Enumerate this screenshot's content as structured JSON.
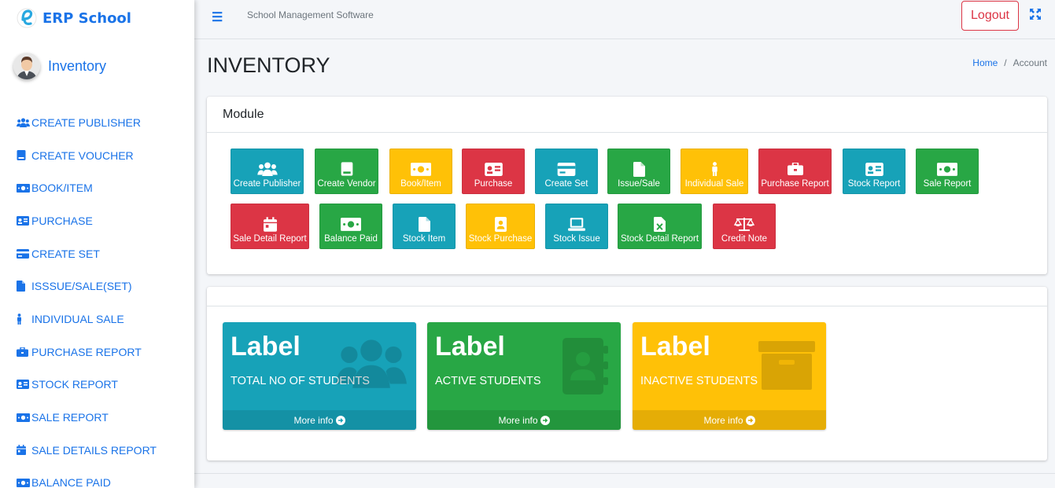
{
  "brand": {
    "name": "ERP School"
  },
  "user": {
    "name": "Inventory"
  },
  "sidebar": {
    "items": [
      {
        "label": "CREATE PUBLISHER",
        "icon": "users-icon"
      },
      {
        "label": "CREATE VOUCHER",
        "icon": "book-icon"
      },
      {
        "label": "BOOK/ITEM",
        "icon": "money-icon"
      },
      {
        "label": "PURCHASE",
        "icon": "id-card-icon"
      },
      {
        "label": "CREATE SET",
        "icon": "credit-card-icon"
      },
      {
        "label": "ISSSUE/SALE(SET)",
        "icon": "file-icon"
      },
      {
        "label": "INDIVIDUAL SALE",
        "icon": "person-icon"
      },
      {
        "label": "PURCHASE REPORT",
        "icon": "briefcase-icon"
      },
      {
        "label": "STOCK REPORT",
        "icon": "id-card-icon"
      },
      {
        "label": "SALE REPORT",
        "icon": "money-icon"
      },
      {
        "label": "SALE DETAILS REPORT",
        "icon": "calendar-icon"
      },
      {
        "label": "BALANCE PAID",
        "icon": "money-icon"
      }
    ]
  },
  "topbar": {
    "app_name": "School Management Software",
    "logout_label": "Logout"
  },
  "header": {
    "title": "INVENTORY",
    "breadcrumb_home": "Home",
    "breadcrumb_sep": "/",
    "breadcrumb_current": "Account"
  },
  "module": {
    "title": "Module",
    "buttons": [
      {
        "label": "Create Publisher",
        "color": "#17a2b8",
        "icon": "users-icon"
      },
      {
        "label": "Create Vendor",
        "color": "#28a745",
        "icon": "book-icon"
      },
      {
        "label": "Book/Item",
        "color": "#ffc107",
        "icon": "money-icon"
      },
      {
        "label": "Purchase",
        "color": "#dc3545",
        "icon": "id-card-icon"
      },
      {
        "label": "Create Set",
        "color": "#17a2b8",
        "icon": "credit-card-icon"
      },
      {
        "label": "Issue/Sale",
        "color": "#28a745",
        "icon": "file-icon"
      },
      {
        "label": "Individual Sale",
        "color": "#ffc107",
        "icon": "person-icon"
      },
      {
        "label": "Purchase Report",
        "color": "#dc3545",
        "icon": "briefcase-icon"
      },
      {
        "label": "Stock Report",
        "color": "#17a2b8",
        "icon": "id-card-icon"
      },
      {
        "label": "Sale Report",
        "color": "#28a745",
        "icon": "money-icon"
      },
      {
        "label": "Sale Detail Report",
        "color": "#dc3545",
        "icon": "calendar-icon"
      },
      {
        "label": "Balance Paid",
        "color": "#28a745",
        "icon": "money-icon"
      },
      {
        "label": "Stock Item",
        "color": "#17a2b8",
        "icon": "file-icon"
      },
      {
        "label": "Stock Purchase",
        "color": "#ffc107",
        "icon": "contact-icon"
      },
      {
        "label": "Stock Issue",
        "color": "#17a2b8",
        "icon": "laptop-icon"
      },
      {
        "label": "Stock Detail Report",
        "color": "#28a745",
        "icon": "excel-file-icon"
      },
      {
        "label": "Credit Note",
        "color": "#dc3545",
        "icon": "balance-scale-icon"
      }
    ]
  },
  "stats": [
    {
      "value": "Label",
      "text": "TOTAL NO OF STUDENTS",
      "footer": "More info",
      "color": "#17a2b8",
      "icon": "users-icon"
    },
    {
      "value": "Label",
      "text": "ACTIVE STUDENTS",
      "footer": "More info",
      "color": "#28a745",
      "icon": "address-book-icon"
    },
    {
      "value": "Label",
      "text": "INACTIVE STUDENTS",
      "footer": "More info",
      "color": "#ffc107",
      "icon": "archive-icon"
    }
  ]
}
